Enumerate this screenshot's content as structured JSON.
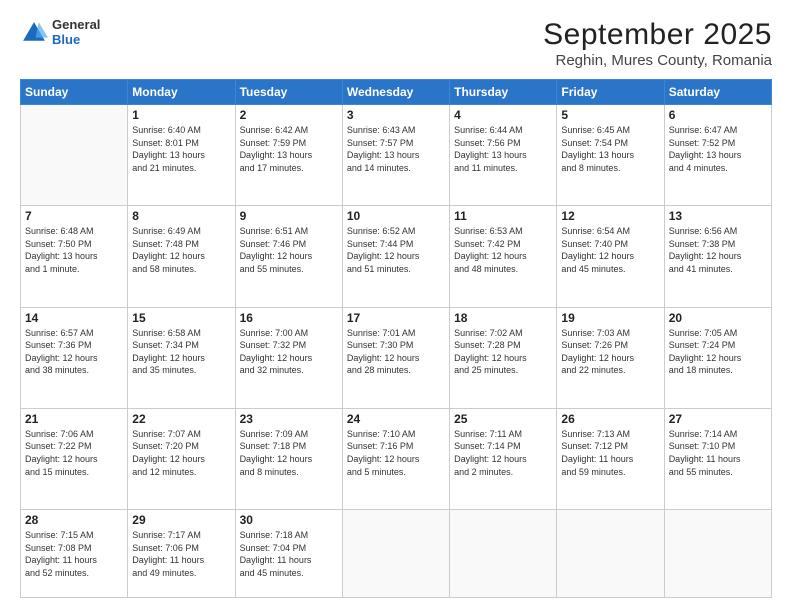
{
  "header": {
    "logo_general": "General",
    "logo_blue": "Blue",
    "title": "September 2025",
    "subtitle": "Reghin, Mures County, Romania"
  },
  "days_of_week": [
    "Sunday",
    "Monday",
    "Tuesday",
    "Wednesday",
    "Thursday",
    "Friday",
    "Saturday"
  ],
  "weeks": [
    [
      {
        "day": "",
        "info": ""
      },
      {
        "day": "1",
        "info": "Sunrise: 6:40 AM\nSunset: 8:01 PM\nDaylight: 13 hours\nand 21 minutes."
      },
      {
        "day": "2",
        "info": "Sunrise: 6:42 AM\nSunset: 7:59 PM\nDaylight: 13 hours\nand 17 minutes."
      },
      {
        "day": "3",
        "info": "Sunrise: 6:43 AM\nSunset: 7:57 PM\nDaylight: 13 hours\nand 14 minutes."
      },
      {
        "day": "4",
        "info": "Sunrise: 6:44 AM\nSunset: 7:56 PM\nDaylight: 13 hours\nand 11 minutes."
      },
      {
        "day": "5",
        "info": "Sunrise: 6:45 AM\nSunset: 7:54 PM\nDaylight: 13 hours\nand 8 minutes."
      },
      {
        "day": "6",
        "info": "Sunrise: 6:47 AM\nSunset: 7:52 PM\nDaylight: 13 hours\nand 4 minutes."
      }
    ],
    [
      {
        "day": "7",
        "info": "Sunrise: 6:48 AM\nSunset: 7:50 PM\nDaylight: 13 hours\nand 1 minute."
      },
      {
        "day": "8",
        "info": "Sunrise: 6:49 AM\nSunset: 7:48 PM\nDaylight: 12 hours\nand 58 minutes."
      },
      {
        "day": "9",
        "info": "Sunrise: 6:51 AM\nSunset: 7:46 PM\nDaylight: 12 hours\nand 55 minutes."
      },
      {
        "day": "10",
        "info": "Sunrise: 6:52 AM\nSunset: 7:44 PM\nDaylight: 12 hours\nand 51 minutes."
      },
      {
        "day": "11",
        "info": "Sunrise: 6:53 AM\nSunset: 7:42 PM\nDaylight: 12 hours\nand 48 minutes."
      },
      {
        "day": "12",
        "info": "Sunrise: 6:54 AM\nSunset: 7:40 PM\nDaylight: 12 hours\nand 45 minutes."
      },
      {
        "day": "13",
        "info": "Sunrise: 6:56 AM\nSunset: 7:38 PM\nDaylight: 12 hours\nand 41 minutes."
      }
    ],
    [
      {
        "day": "14",
        "info": "Sunrise: 6:57 AM\nSunset: 7:36 PM\nDaylight: 12 hours\nand 38 minutes."
      },
      {
        "day": "15",
        "info": "Sunrise: 6:58 AM\nSunset: 7:34 PM\nDaylight: 12 hours\nand 35 minutes."
      },
      {
        "day": "16",
        "info": "Sunrise: 7:00 AM\nSunset: 7:32 PM\nDaylight: 12 hours\nand 32 minutes."
      },
      {
        "day": "17",
        "info": "Sunrise: 7:01 AM\nSunset: 7:30 PM\nDaylight: 12 hours\nand 28 minutes."
      },
      {
        "day": "18",
        "info": "Sunrise: 7:02 AM\nSunset: 7:28 PM\nDaylight: 12 hours\nand 25 minutes."
      },
      {
        "day": "19",
        "info": "Sunrise: 7:03 AM\nSunset: 7:26 PM\nDaylight: 12 hours\nand 22 minutes."
      },
      {
        "day": "20",
        "info": "Sunrise: 7:05 AM\nSunset: 7:24 PM\nDaylight: 12 hours\nand 18 minutes."
      }
    ],
    [
      {
        "day": "21",
        "info": "Sunrise: 7:06 AM\nSunset: 7:22 PM\nDaylight: 12 hours\nand 15 minutes."
      },
      {
        "day": "22",
        "info": "Sunrise: 7:07 AM\nSunset: 7:20 PM\nDaylight: 12 hours\nand 12 minutes."
      },
      {
        "day": "23",
        "info": "Sunrise: 7:09 AM\nSunset: 7:18 PM\nDaylight: 12 hours\nand 8 minutes."
      },
      {
        "day": "24",
        "info": "Sunrise: 7:10 AM\nSunset: 7:16 PM\nDaylight: 12 hours\nand 5 minutes."
      },
      {
        "day": "25",
        "info": "Sunrise: 7:11 AM\nSunset: 7:14 PM\nDaylight: 12 hours\nand 2 minutes."
      },
      {
        "day": "26",
        "info": "Sunrise: 7:13 AM\nSunset: 7:12 PM\nDaylight: 11 hours\nand 59 minutes."
      },
      {
        "day": "27",
        "info": "Sunrise: 7:14 AM\nSunset: 7:10 PM\nDaylight: 11 hours\nand 55 minutes."
      }
    ],
    [
      {
        "day": "28",
        "info": "Sunrise: 7:15 AM\nSunset: 7:08 PM\nDaylight: 11 hours\nand 52 minutes."
      },
      {
        "day": "29",
        "info": "Sunrise: 7:17 AM\nSunset: 7:06 PM\nDaylight: 11 hours\nand 49 minutes."
      },
      {
        "day": "30",
        "info": "Sunrise: 7:18 AM\nSunset: 7:04 PM\nDaylight: 11 hours\nand 45 minutes."
      },
      {
        "day": "",
        "info": ""
      },
      {
        "day": "",
        "info": ""
      },
      {
        "day": "",
        "info": ""
      },
      {
        "day": "",
        "info": ""
      }
    ]
  ]
}
